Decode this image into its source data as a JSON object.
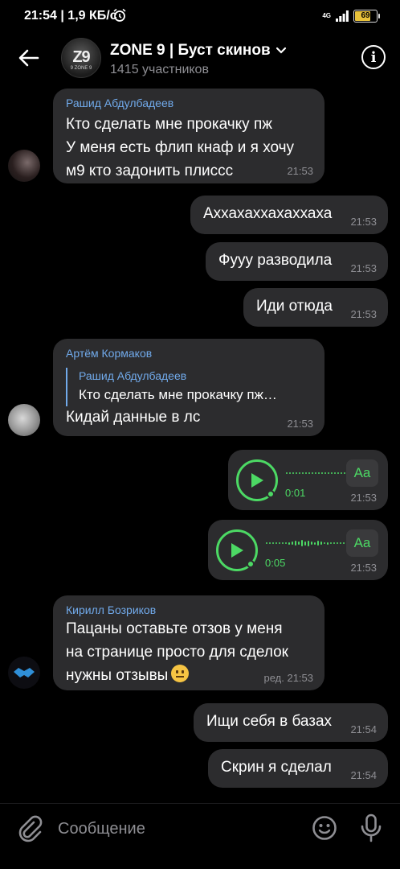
{
  "status": {
    "time": "21:54",
    "speed": "1,9 КБ/с",
    "network": "4G",
    "battery": "69",
    "battery_level": 0.69
  },
  "header": {
    "title": "ZONE 9 | Буст скинов",
    "subtitle": "1415 участников",
    "avatar_text": "Z9",
    "avatar_small": "9 ZONE 9"
  },
  "messages": [
    {
      "sender": "Рашид Абдулбадеев",
      "lines": [
        "Кто сделать мне прокачку пж",
        "У меня есть флип кнаф и я хочу",
        "м9 кто задонить плиссс"
      ],
      "time": "21:53"
    },
    {
      "text": "Аххахаххахаххаха",
      "time": "21:53"
    },
    {
      "text": "Фууу разводила",
      "time": "21:53"
    },
    {
      "text": "Иди отюда",
      "time": "21:53"
    },
    {
      "sender": "Артём Кормаков",
      "quote_sender": "Рашид Абдулбадеев",
      "quote_text": "Кто сделать мне прокачку пж…",
      "text": "Кидай данные в лс",
      "time": "21:53"
    },
    {
      "duration": "0:01",
      "aa": "Aa",
      "time": "21:53"
    },
    {
      "duration": "0:05",
      "aa": "Aa",
      "time": "21:53"
    },
    {
      "sender": "Кирилл Бозриков",
      "lines": [
        "Пацаны оставьте отзов у  меня",
        "на странице просто для сделок",
        "нужны отзывы"
      ],
      "time": "ред. 21:53"
    },
    {
      "text": "Ищи себя в базах",
      "time": "21:54"
    },
    {
      "text": "Скрин я сделал",
      "time": "21:54"
    }
  ],
  "composer": {
    "placeholder": "Сообщение"
  },
  "colors": {
    "accent_green": "#4cd964",
    "sender_blue": "#71aaeb",
    "bubble": "#2c2c2e"
  }
}
